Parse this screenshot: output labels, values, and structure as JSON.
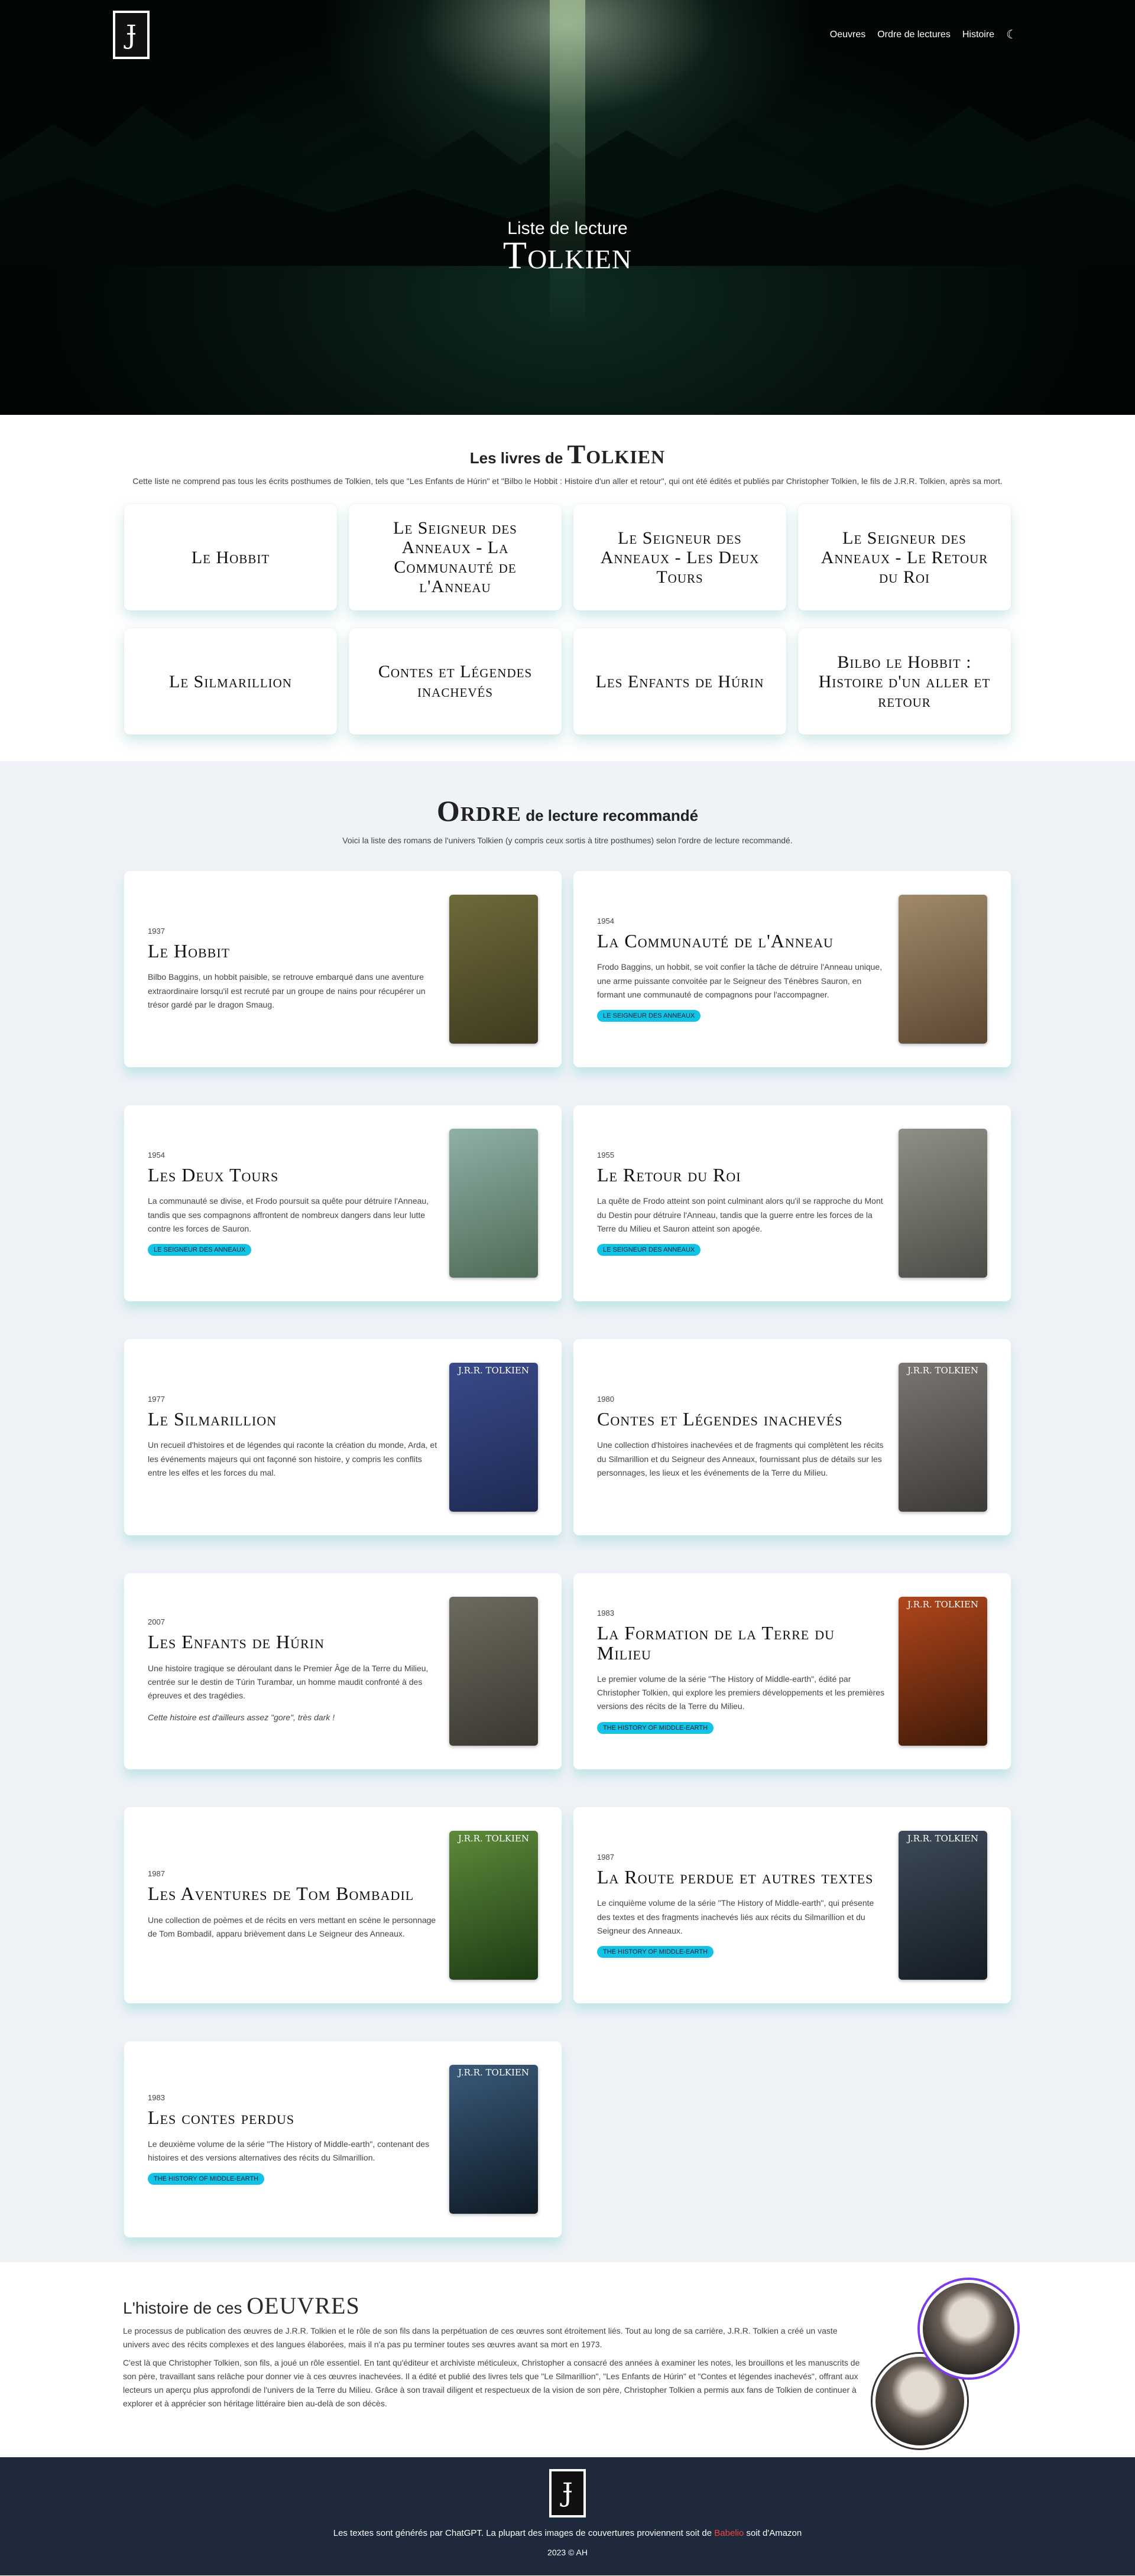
{
  "nav": {
    "logo": "Ɉ",
    "items": [
      "Oeuvres",
      "Ordre de lectures",
      "Histoire"
    ],
    "theme_icon": "moon-icon"
  },
  "hero": {
    "subtitle": "Liste de lecture",
    "title": "Tolkien"
  },
  "books": {
    "title_prefix": "Les livres de",
    "title_name": "Tolkien",
    "intro": "Cette liste ne comprend pas tous les écrits posthumes de Tolkien, tels que \"Les Enfants de Húrin\" et \"Bilbo le Hobbit : Histoire d'un aller et retour\", qui ont été édités et publiés par Christopher Tolkien, le fils de J.R.R. Tolkien, après sa mort.",
    "items": [
      "Le Hobbit",
      "Le Seigneur des Anneaux - La Communauté de l'Anneau",
      "Le Seigneur des Anneaux - Les Deux Tours",
      "Le Seigneur des Anneaux - Le Retour du Roi",
      "Le Silmarillion",
      "Contes et Légendes inachevés",
      "Les Enfants de Húrin",
      "Bilbo le Hobbit : Histoire d'un aller et retour"
    ]
  },
  "order": {
    "title_name": "Ordre",
    "title_suffix": "de lecture recommandé",
    "intro": "Voici la liste des romans de l'univers Tolkien (y compris ceux sortis à titre posthumes) selon l'ordre de lecture recommandé.",
    "items": [
      {
        "year": "1937",
        "title": "Le Hobbit",
        "desc": "Bilbo Baggins, un hobbit paisible, se retrouve embarqué dans une aventure extraordinaire lorsqu'il est recruté par un groupe de nains pour récupérer un trésor gardé par le dragon Smaug.",
        "tag": "",
        "note": "",
        "cover_text": "",
        "cover_colors": [
          "#6f6a3a",
          "#3e3a1f"
        ]
      },
      {
        "year": "1954",
        "title": "La Communauté de l'Anneau",
        "desc": "Frodo Baggins, un hobbit, se voit confier la tâche de détruire l'Anneau unique, une arme puissante convoitée par le Seigneur des Ténèbres Sauron, en formant une communauté de compagnons pour l'accompagner.",
        "tag": "Le Seigneur des Anneaux",
        "note": "",
        "cover_text": "",
        "cover_colors": [
          "#a08a6a",
          "#5b4733"
        ]
      },
      {
        "year": "1954",
        "title": "Les Deux Tours",
        "desc": "La communauté se divise, et Frodo poursuit sa quête pour détruire l'Anneau, tandis que ses compagnons affrontent de nombreux dangers dans leur lutte contre les forces de Sauron.",
        "tag": "Le Seigneur des Anneaux",
        "note": "",
        "cover_text": "",
        "cover_colors": [
          "#8fb0a8",
          "#4f6a54"
        ]
      },
      {
        "year": "1955",
        "title": "Le Retour du Roi",
        "desc": "La quête de Frodo atteint son point culminant alors qu'il se rapproche du Mont du Destin pour détruire l'Anneau, tandis que la guerre entre les forces de la Terre du Milieu et Sauron atteint son apogée.",
        "tag": "Le Seigneur des Anneaux",
        "note": "",
        "cover_text": "",
        "cover_colors": [
          "#8f8f88",
          "#4d4b45"
        ]
      },
      {
        "year": "1977",
        "title": "Le Silmarillion",
        "desc": "Un recueil d'histoires et de légendes qui raconte la création du monde, Arda, et les événements majeurs qui ont façonné son histoire, y compris les conflits entre les elfes et les forces du mal.",
        "tag": "",
        "note": "",
        "cover_text": "J.R.R. TOLKIEN",
        "cover_colors": [
          "#3a4a8a",
          "#1e2a52"
        ]
      },
      {
        "year": "1980",
        "title": "Contes et Légendes inachevés",
        "desc": "Une collection d'histoires inachevées et de fragments qui complètent les récits du Silmarillion et du Seigneur des Anneaux, fournissant plus de détails sur les personnages, les lieux et les événements de la Terre du Milieu.",
        "tag": "",
        "note": "",
        "cover_text": "J.R.R. TOLKIEN",
        "cover_colors": [
          "#7a7672",
          "#3c3a37"
        ]
      },
      {
        "year": "2007",
        "title": "Les Enfants de Húrin",
        "desc": "Une histoire tragique se déroulant dans le Premier Âge de la Terre du Milieu, centrée sur le destin de Túrin Turambar, un homme maudit confronté à des épreuves et des tragédies.",
        "tag": "",
        "note": "Cette histoire est d'ailleurs assez \"gore\", très dark !",
        "cover_text": "",
        "cover_colors": [
          "#6d6a5f",
          "#3a372f"
        ]
      },
      {
        "year": "1983",
        "title": "La Formation de la Terre du Milieu",
        "desc": "Le premier volume de la série \"The History of Middle-earth\", édité par Christopher Tolkien, qui explore les premiers développements et les premières versions des récits de la Terre du Milieu.",
        "tag": "The History of Middle-earth",
        "note": "",
        "cover_text": "J.R.R. TOLKIEN",
        "cover_colors": [
          "#b0461c",
          "#3e1a08"
        ]
      },
      {
        "year": "1987",
        "title": "Les Aventures de Tom Bombadil",
        "desc": "Une collection de poèmes et de récits en vers mettant en scène le personnage de Tom Bombadil, apparu brièvement dans Le Seigneur des Anneaux.",
        "tag": "",
        "note": "",
        "cover_text": "J.R.R. TOLKIEN",
        "cover_colors": [
          "#5e8a3a",
          "#1d3a14"
        ]
      },
      {
        "year": "1987",
        "title": "La Route perdue et autres textes",
        "desc": "Le cinquième volume de la série \"The History of Middle-earth\", qui présente des textes et des fragments inachevés liés aux récits du Silmarillion et du Seigneur des Anneaux.",
        "tag": "The History of Middle-earth",
        "note": "",
        "cover_text": "J.R.R. TOLKIEN",
        "cover_colors": [
          "#3c4a58",
          "#141c24"
        ]
      },
      {
        "year": "1983",
        "title": "Les contes perdus",
        "desc": "Le deuxième volume de la série \"The History of Middle-earth\", contenant des histoires et des versions alternatives des récits du Silmarillion.",
        "tag": "The History of Middle-earth",
        "note": "",
        "cover_text": "J.R.R. TOLKIEN",
        "cover_colors": [
          "#3a5a7a",
          "#0e1a24"
        ]
      }
    ]
  },
  "history": {
    "title_prefix": "L'histoire de ces",
    "title_name": "OEUVRES",
    "p1": "Le processus de publication des œuvres de J.R.R. Tolkien et le rôle de son fils dans la perpétuation de ces œuvres sont étroitement liés. Tout au long de sa carrière, J.R.R. Tolkien a créé un vaste univers avec des récits complexes et des langues élaborées, mais il n'a pas pu terminer toutes ses œuvres avant sa mort en 1973.",
    "p2": "C'est là que Christopher Tolkien, son fils, a joué un rôle essentiel. En tant qu'éditeur et archiviste méticuleux, Christopher a consacré des années à examiner les notes, les brouillons et les manuscrits de son père, travaillant sans relâche pour donner vie à ces œuvres inachevées. Il a édité et publié des livres tels que \"Le Silmarillion\", \"Les Enfants de Húrin\" et \"Contes et légendes inachevés\", offrant aux lecteurs un aperçu plus approfondi de l'univers de la Terre du Milieu. Grâce à son travail diligent et respectueux de la vision de son père, Christopher Tolkien a permis aux fans de Tolkien de continuer à explorer et à apprécier son héritage littéraire bien au-delà de son décès."
  },
  "footer": {
    "text_before": "Les textes sont générés par ChatGPT. La plupart des images de couvertures proviennent soit de ",
    "link": "Babelio",
    "text_after": " soit d'Amazon",
    "copyright": "2023 © AH"
  },
  "colors": {
    "tag": "#13c3e6",
    "footer_bg": "#1e293b",
    "order_bg": "#eff2f7",
    "portrait_ring": "#7c3aed",
    "link": "#ef4444"
  }
}
